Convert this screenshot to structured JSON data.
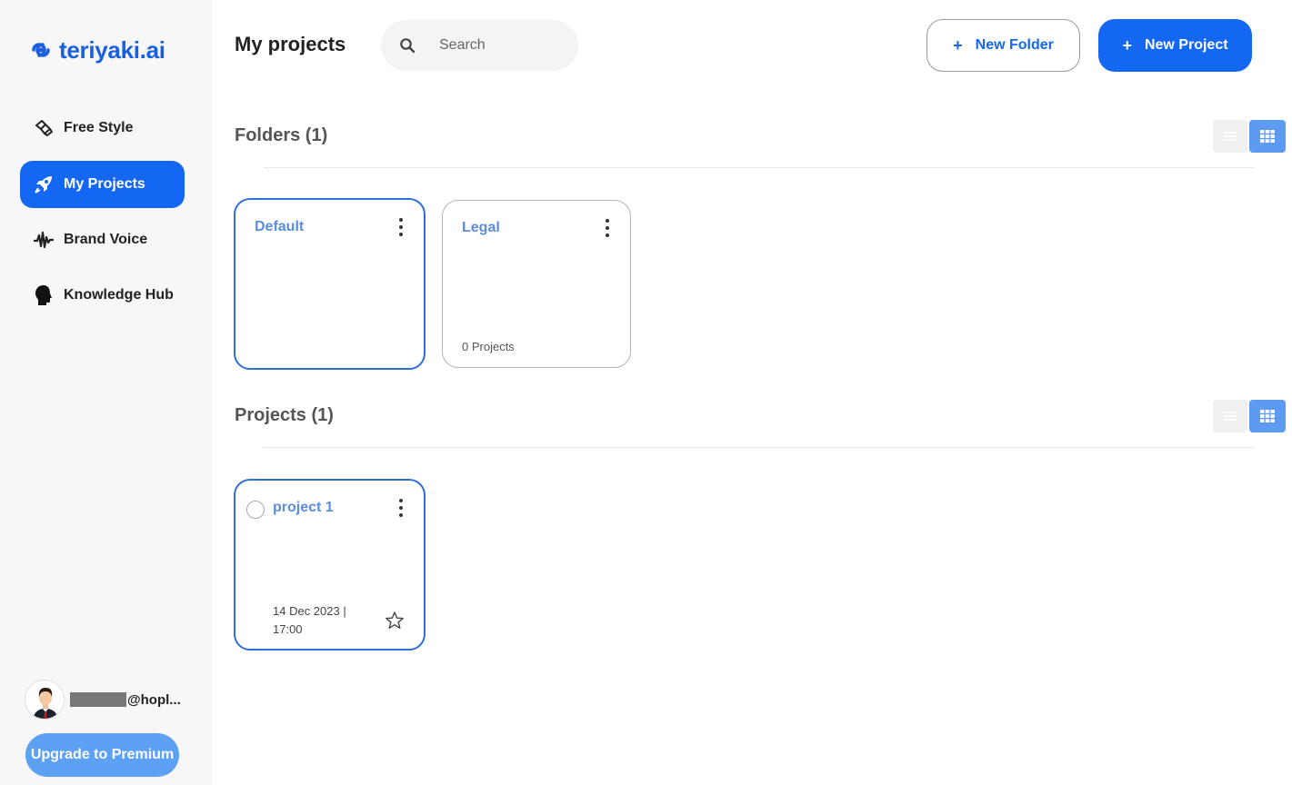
{
  "brand": {
    "name": "teriyaki.ai",
    "color": "#1a5fe0"
  },
  "sidebar": {
    "items": [
      {
        "label": "Free Style",
        "icon": "free-style-icon",
        "active": false
      },
      {
        "label": "My Projects",
        "icon": "rocket-icon",
        "active": true
      },
      {
        "label": "Brand Voice",
        "icon": "waveform-icon",
        "active": false
      },
      {
        "label": "Knowledge Hub",
        "icon": "head-icon",
        "active": false
      }
    ],
    "user": {
      "email_visible": "@hopl..."
    },
    "upgrade_label": "Upgrade to Premium"
  },
  "header": {
    "title": "My projects",
    "search_placeholder": "Search",
    "new_folder_label": "New Folder",
    "new_project_label": "New Project"
  },
  "folders": {
    "title": "Folders (1)",
    "items": [
      {
        "name": "Default",
        "count": "",
        "selected": true
      },
      {
        "name": "Legal",
        "count": "0 Projects",
        "selected": false
      }
    ]
  },
  "projects": {
    "title": "Projects (1)",
    "items": [
      {
        "name": "project 1",
        "date": "14 Dec 2023 |",
        "time": "17:00",
        "selected": true
      }
    ]
  },
  "colors": {
    "accent": "#1467f2",
    "upgrade": "#5da1f5",
    "card_title": "#5b8dde",
    "grid_toggle": "#5d9bf3"
  }
}
